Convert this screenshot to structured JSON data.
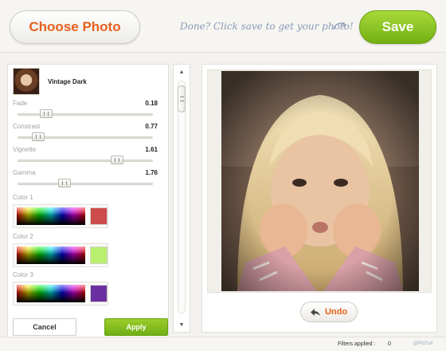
{
  "header": {
    "choose_label": "Choose Photo",
    "hint": "Done? Click save to get your photo!",
    "save_label": "Save"
  },
  "filter": {
    "name": "Vintage Dark",
    "sliders": [
      {
        "label": "Fade",
        "value": "0.18",
        "level": 0.18
      },
      {
        "label": "Constrast",
        "value": "0.77",
        "level": 0.12
      },
      {
        "label": "Vignette",
        "value": "1.61",
        "level": 0.76
      },
      {
        "label": "Gamma",
        "value": "1.76",
        "level": 0.33
      }
    ],
    "colors": [
      {
        "label": "Color 1",
        "swatch": "#cc4b4b"
      },
      {
        "label": "Color 2",
        "swatch": "#b8ef6e"
      },
      {
        "label": "Color 3",
        "swatch": "#6a2fa0"
      }
    ],
    "cancel_label": "Cancel",
    "apply_label": "Apply"
  },
  "scroll": {
    "up_icon": "▲",
    "down_icon": "▼"
  },
  "preview": {
    "undo_label": "Undo"
  },
  "footer": {
    "filters_label": "Filters applied :",
    "filters_count": "0",
    "credit": "@PicFull"
  },
  "colors": {
    "accent_orange": "#e8601c",
    "accent_green": "#7cbc18"
  }
}
